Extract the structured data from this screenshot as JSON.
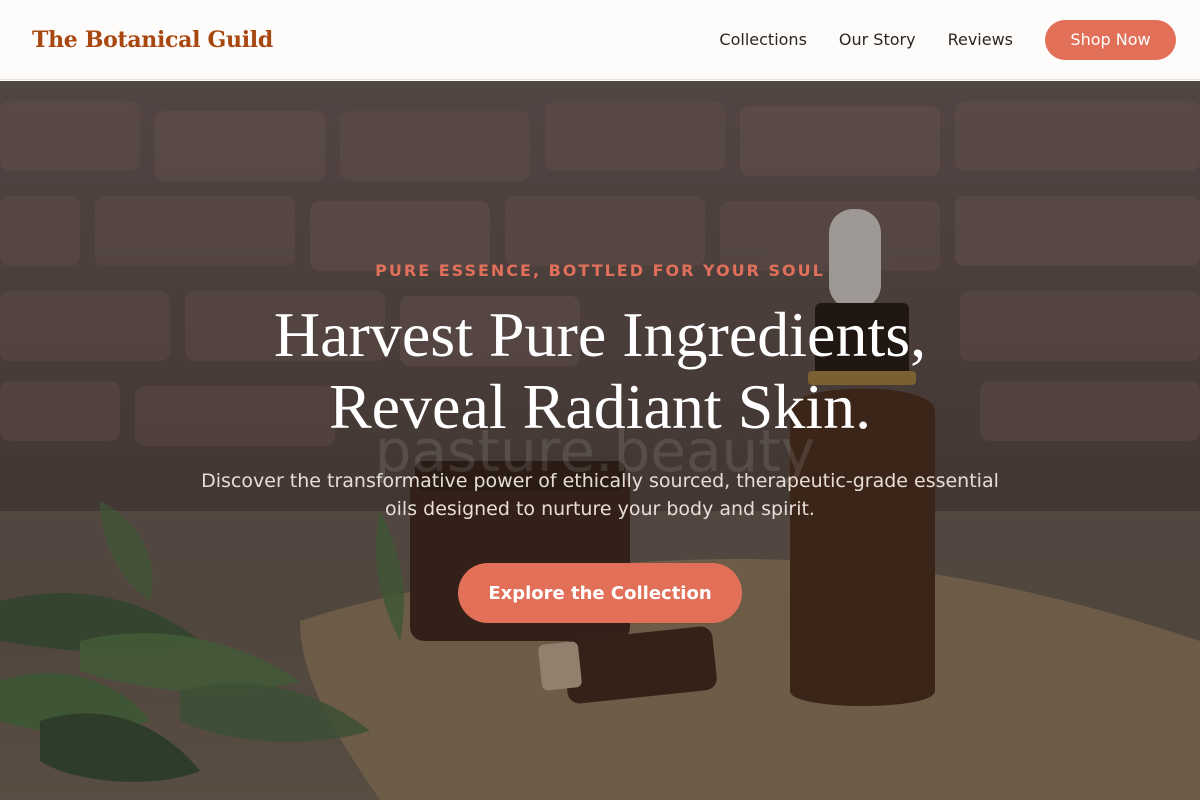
{
  "header": {
    "brand": "The Botanical Guild",
    "nav": [
      {
        "label": "Collections"
      },
      {
        "label": "Our Story"
      },
      {
        "label": "Reviews"
      }
    ],
    "cta_label": "Shop Now"
  },
  "hero": {
    "eyebrow": "PURE ESSENCE, BOTTLED FOR YOUR SOUL",
    "headline_line1": "Harvest Pure Ingredients,",
    "headline_line2": "Reveal Radiant Skin.",
    "subtext_line1": "Discover the transformative power of ethically sourced, therapeutic-grade essential",
    "subtext_line2": "oils designed to nurture your body and spirit.",
    "cta_label": "Explore the Collection",
    "watermark": "pasture.beauty"
  },
  "colors": {
    "brand": "#a8470f",
    "accent": "#e27059"
  }
}
